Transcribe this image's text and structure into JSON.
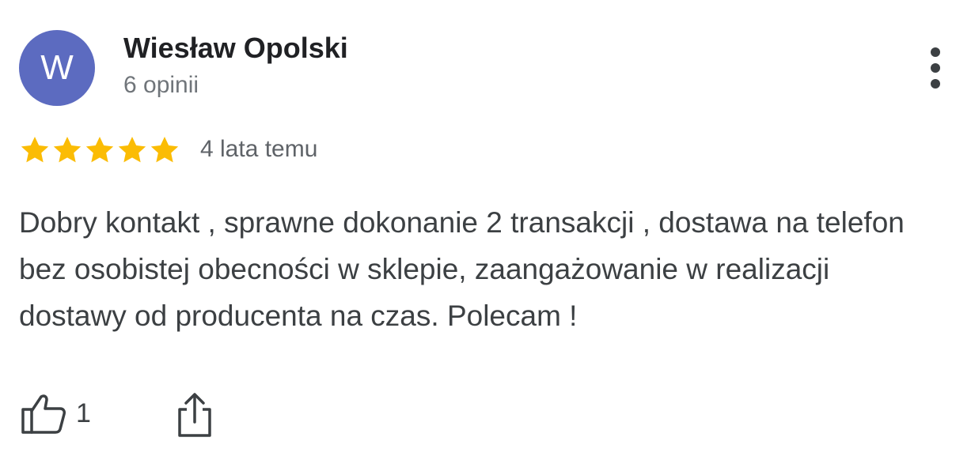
{
  "author": {
    "initial": "W",
    "name": "Wiesław Opolski",
    "review_count": "6 opinii",
    "avatar_color": "#5c6bc0"
  },
  "rating": {
    "stars": 5,
    "max_stars": 5,
    "star_color": "#fbbc04",
    "date": "4 lata temu"
  },
  "review": {
    "text": "Dobry kontakt , sprawne dokonanie 2 transakcji , dostawa na telefon bez osobistej obecności w sklepie, zaangażowanie w realizacji dostawy od producenta na czas. Polecam !"
  },
  "actions": {
    "like_icon": "thumbs-up-icon",
    "like_count": "1",
    "share_icon": "share-icon",
    "more_icon": "more-vert-icon"
  }
}
